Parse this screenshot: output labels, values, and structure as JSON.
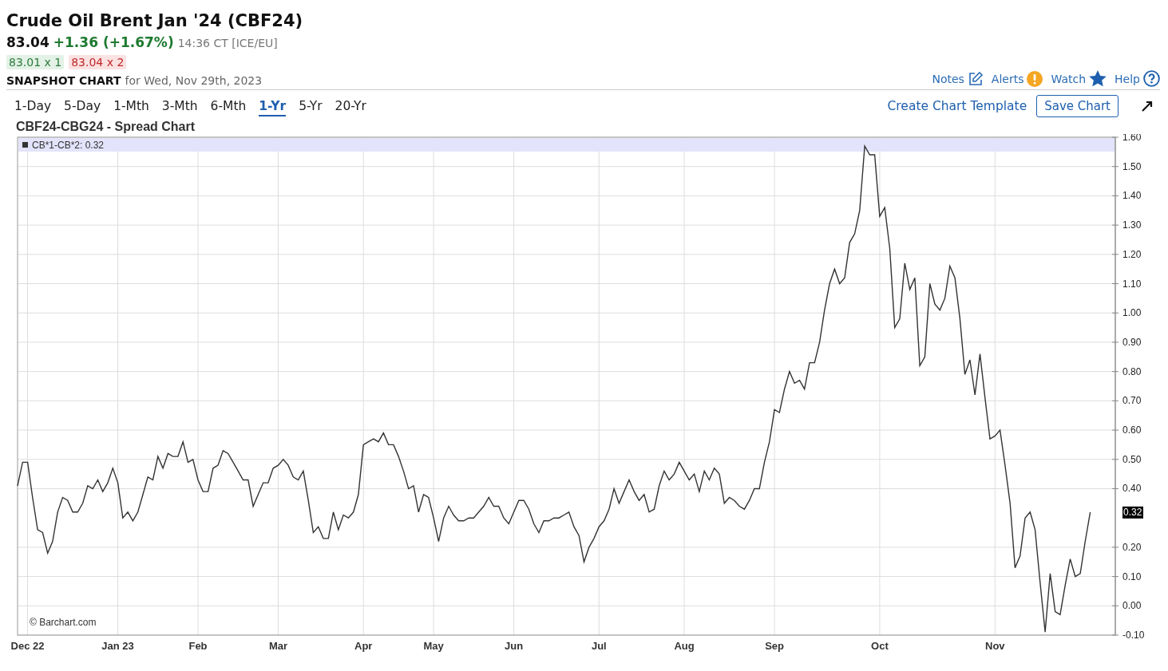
{
  "header": {
    "title": "Crude Oil Brent Jan '24 (CBF24)",
    "last": "83.04",
    "change": "+1.36 (+1.67%)",
    "time": "14:36 CT [ICE/EU]",
    "bid": "83.01 x 1",
    "ask": "83.04 x 2",
    "snapshot_label": "SNAPSHOT CHART",
    "snapshot_date": "for Wed, Nov 29th, 2023"
  },
  "links": [
    {
      "label": "Notes",
      "kind": "notes"
    },
    {
      "label": "Alerts",
      "kind": "alerts"
    },
    {
      "label": "Watch",
      "kind": "watch"
    },
    {
      "label": "Help",
      "kind": "help"
    }
  ],
  "periods": [
    {
      "label": "1-Day",
      "selected": false
    },
    {
      "label": "5-Day",
      "selected": false
    },
    {
      "label": "1-Mth",
      "selected": false
    },
    {
      "label": "3-Mth",
      "selected": false
    },
    {
      "label": "6-Mth",
      "selected": false
    },
    {
      "label": "1-Yr",
      "selected": true
    },
    {
      "label": "5-Yr",
      "selected": false
    },
    {
      "label": "20-Yr",
      "selected": false
    }
  ],
  "toolbar": {
    "template_link": "Create Chart Template",
    "save_button": "Save Chart"
  },
  "chart": {
    "title": "CBF24-CBG24 - Spread Chart",
    "legend_reading": ": 0.32",
    "last_flag": "0.32",
    "credit": "© Barchart.com",
    "chart_data": {
      "type": "line",
      "grid": true,
      "ylim": [
        -0.1,
        1.6
      ],
      "categories": [
        null,
        null,
        "Dec 22",
        null,
        null,
        null,
        null,
        null,
        null,
        null,
        null,
        null,
        null,
        null,
        null,
        null,
        null,
        null,
        null,
        null,
        "Jan 23",
        null,
        null,
        null,
        null,
        null,
        null,
        null,
        null,
        null,
        null,
        null,
        null,
        null,
        null,
        null,
        "Feb",
        null,
        null,
        null,
        null,
        null,
        null,
        null,
        null,
        null,
        null,
        null,
        null,
        null,
        null,
        null,
        "Mar",
        null,
        null,
        null,
        null,
        null,
        null,
        null,
        null,
        null,
        null,
        null,
        null,
        null,
        null,
        null,
        null,
        "Apr",
        null,
        null,
        null,
        null,
        null,
        null,
        null,
        null,
        null,
        null,
        null,
        null,
        null,
        "May",
        null,
        null,
        null,
        null,
        null,
        null,
        null,
        null,
        null,
        null,
        null,
        null,
        null,
        null,
        null,
        "Jun",
        null,
        null,
        null,
        null,
        null,
        null,
        null,
        null,
        null,
        null,
        null,
        null,
        null,
        null,
        null,
        null,
        "Jul",
        null,
        null,
        null,
        null,
        null,
        null,
        null,
        null,
        null,
        null,
        null,
        null,
        null,
        null,
        null,
        null,
        "Aug",
        null,
        null,
        null,
        null,
        null,
        null,
        null,
        null,
        null,
        null,
        null,
        null,
        null,
        null,
        null,
        null,
        null,
        "Sep",
        null,
        null,
        null,
        null,
        null,
        null,
        null,
        null,
        null,
        null,
        null,
        null,
        null,
        null,
        null,
        null,
        null,
        null,
        null,
        null,
        "Oct",
        null,
        null,
        null,
        null,
        null,
        null,
        null,
        null,
        null,
        null,
        null,
        null,
        null,
        null,
        null,
        null,
        null,
        null,
        null,
        null,
        null,
        null,
        "Nov",
        null,
        null,
        null,
        null,
        null,
        null,
        null,
        null,
        null,
        null,
        null,
        null,
        null,
        null,
        null,
        null,
        null,
        null,
        null
      ],
      "yticks": [
        {
          "value": -0.1,
          "label": "-0.10"
        },
        {
          "value": 0,
          "label": "0.00"
        },
        {
          "value": 0.1,
          "label": "0.10"
        },
        {
          "value": 0.2,
          "label": "0.20"
        },
        {
          "value": 0.4,
          "label": "0.40"
        },
        {
          "value": 0.5,
          "label": "0.50"
        },
        {
          "value": 0.6,
          "label": "0.60"
        },
        {
          "value": 0.7,
          "label": "0.70"
        },
        {
          "value": 0.8,
          "label": "0.80"
        },
        {
          "value": 0.9,
          "label": "0.90"
        },
        {
          "value": 1.0,
          "label": "1.00"
        },
        {
          "value": 1.1,
          "label": "1.10"
        },
        {
          "value": 1.2,
          "label": "1.20"
        },
        {
          "value": 1.3,
          "label": "1.30"
        },
        {
          "value": 1.4,
          "label": "1.40"
        },
        {
          "value": 1.5,
          "label": "1.50"
        },
        {
          "value": 1.6,
          "label": "1.60"
        }
      ],
      "series": [
        {
          "name": "CB*1-CB*2",
          "color": "#333333",
          "values": [
            0.41,
            0.49,
            0.49,
            0.37,
            0.26,
            0.25,
            0.18,
            0.22,
            0.32,
            0.37,
            0.36,
            0.32,
            0.32,
            0.35,
            0.41,
            0.4,
            0.43,
            0.39,
            0.42,
            0.47,
            0.42,
            0.3,
            0.32,
            0.29,
            0.32,
            0.38,
            0.44,
            0.43,
            0.51,
            0.47,
            0.52,
            0.51,
            0.51,
            0.56,
            0.49,
            0.5,
            0.43,
            0.39,
            0.39,
            0.47,
            0.48,
            0.53,
            0.52,
            0.49,
            0.46,
            0.43,
            0.43,
            0.34,
            0.38,
            0.42,
            0.42,
            0.47,
            0.48,
            0.5,
            0.48,
            0.44,
            0.43,
            0.46,
            0.36,
            0.25,
            0.27,
            0.23,
            0.23,
            0.32,
            0.26,
            0.31,
            0.3,
            0.32,
            0.38,
            0.55,
            0.56,
            0.57,
            0.56,
            0.59,
            0.55,
            0.55,
            0.51,
            0.46,
            0.4,
            0.41,
            0.32,
            0.38,
            0.37,
            0.3,
            0.22,
            0.3,
            0.34,
            0.31,
            0.29,
            0.29,
            0.3,
            0.3,
            0.32,
            0.34,
            0.37,
            0.34,
            0.34,
            0.3,
            0.28,
            0.32,
            0.36,
            0.36,
            0.33,
            0.28,
            0.25,
            0.29,
            0.29,
            0.3,
            0.3,
            0.31,
            0.32,
            0.27,
            0.24,
            0.15,
            0.2,
            0.23,
            0.27,
            0.29,
            0.33,
            0.4,
            0.35,
            0.39,
            0.43,
            0.39,
            0.36,
            0.38,
            0.32,
            0.33,
            0.41,
            0.46,
            0.43,
            0.45,
            0.49,
            0.46,
            0.43,
            0.45,
            0.39,
            0.46,
            0.43,
            0.47,
            0.45,
            0.35,
            0.37,
            0.36,
            0.34,
            0.33,
            0.36,
            0.4,
            0.4,
            0.49,
            0.56,
            0.67,
            0.66,
            0.74,
            0.8,
            0.76,
            0.77,
            0.74,
            0.83,
            0.83,
            0.9,
            1.01,
            1.1,
            1.15,
            1.1,
            1.12,
            1.24,
            1.27,
            1.35,
            1.57,
            1.54,
            1.54,
            1.33,
            1.36,
            1.22,
            0.95,
            0.98,
            1.17,
            1.08,
            1.12,
            0.82,
            0.85,
            1.1,
            1.03,
            1.01,
            1.05,
            1.16,
            1.12,
            0.98,
            0.79,
            0.84,
            0.72,
            0.86,
            0.71,
            0.57,
            0.58,
            0.6,
            0.48,
            0.35,
            0.13,
            0.17,
            0.3,
            0.32,
            0.26,
            0.08,
            -0.09,
            0.11,
            -0.02,
            -0.03,
            0.07,
            0.16,
            0.1,
            0.11,
            0.22,
            0.32
          ]
        }
      ]
    }
  }
}
